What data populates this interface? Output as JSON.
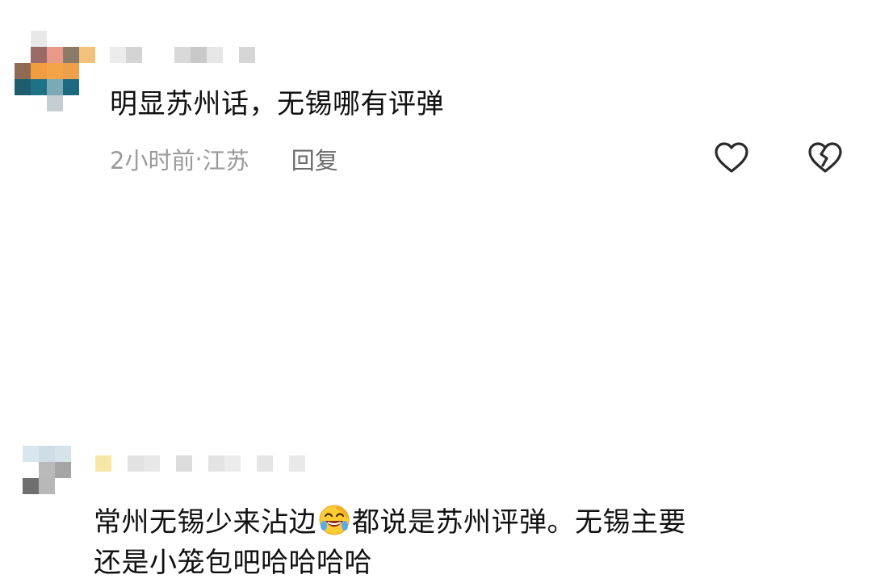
{
  "comments": [
    {
      "text": "明显苏州话，无锡哪有评弹",
      "time": "2小时前",
      "separator": " · ",
      "location": "江苏",
      "reply_label": "回复"
    },
    {
      "text_line1_before": "常州无锡少来沾边",
      "emoji": "rolling-on-floor-laughing-emoji",
      "text_line1_after": "都说是苏州评弹。无锡主要",
      "text_line2": "还是小笼包吧哈哈哈哈"
    }
  ],
  "icons": {
    "like": "heart-outline-icon",
    "dislike": "broken-heart-outline-icon"
  },
  "colors": {
    "text": "#111111",
    "meta": "#9a9a9a",
    "reply": "#6a6a6a",
    "icon": "#2a2a2a"
  }
}
